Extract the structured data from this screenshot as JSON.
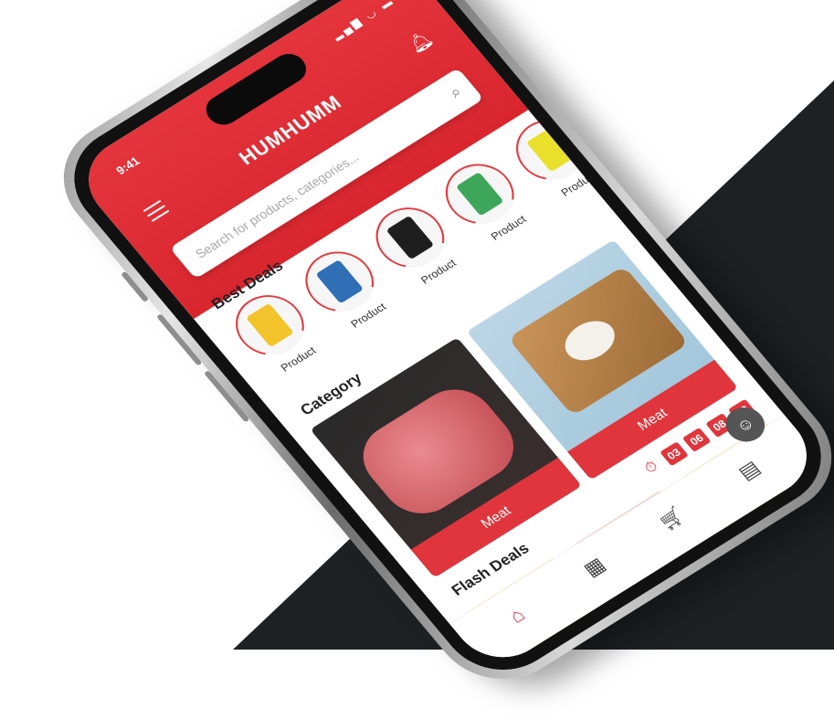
{
  "app": {
    "brand": "HUMHUMM"
  },
  "status": {
    "time": "9:41",
    "icons": "▂▄▆ ◡ ▬"
  },
  "search": {
    "placeholder": "Search for products, categories..."
  },
  "best_deals": {
    "title": "Best Deals",
    "items": [
      {
        "label": "Product",
        "color": "#f3c32b"
      },
      {
        "label": "Product",
        "color": "#2f6fb5"
      },
      {
        "label": "Product",
        "color": "#1e1e1e"
      },
      {
        "label": "Product",
        "color": "#3ea65a"
      },
      {
        "label": "Product",
        "color": "#e8e02a"
      },
      {
        "label": "Pro",
        "color": "#d8d8d8"
      }
    ]
  },
  "category": {
    "title": "Category",
    "items": [
      {
        "label": "Meat"
      },
      {
        "label": "Meat"
      }
    ]
  },
  "flash_deals": {
    "title": "Flash Deals",
    "timer": [
      "03",
      "06",
      "08",
      "22"
    ]
  },
  "tabbar": {
    "home_icon": "home-icon",
    "categories_icon": "grid-icon",
    "cart_icon": "cart-icon",
    "store_icon": "store-icon"
  },
  "colors": {
    "accent": "#e0353c",
    "background_dark": "#1e2124"
  }
}
